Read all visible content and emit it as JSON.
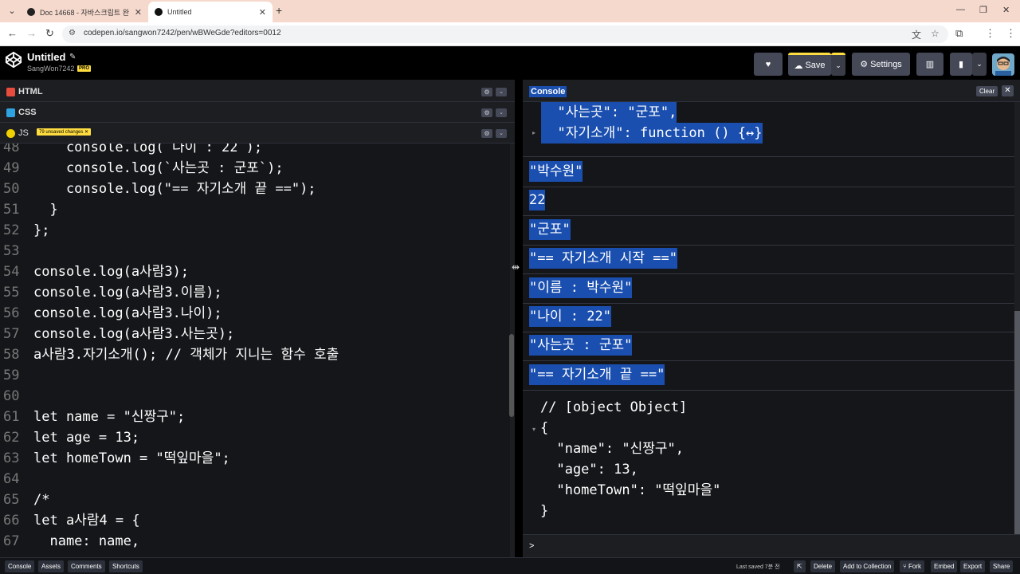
{
  "browser": {
    "tabs": [
      {
        "title": "Doc 14668 - 자바스크립트 완"
      },
      {
        "title": "Untitled"
      }
    ],
    "url": "codepen.io/sangwon7242/pen/wBWeGde?editors=0012"
  },
  "header": {
    "title": "Untitled",
    "user": "SangWon7242",
    "pro_label": "PRO",
    "save_label": "Save",
    "settings_label": "Settings"
  },
  "editors": {
    "html_label": "HTML",
    "css_label": "CSS",
    "js_label": "JS",
    "unsaved": "79 unsaved changes"
  },
  "code_lines": [
    {
      "n": "48",
      "text": "    console.log(`나이 : 22`);"
    },
    {
      "n": "49",
      "text": "    console.log(`사는곳 : 군포`);"
    },
    {
      "n": "50",
      "text": "    console.log(\"== 자기소개 끝 ==\");"
    },
    {
      "n": "51",
      "text": "  }"
    },
    {
      "n": "52",
      "text": "};"
    },
    {
      "n": "53",
      "text": ""
    },
    {
      "n": "54",
      "text": "console.log(a사람3);"
    },
    {
      "n": "55",
      "text": "console.log(a사람3.이름);"
    },
    {
      "n": "56",
      "text": "console.log(a사람3.나이);"
    },
    {
      "n": "57",
      "text": "console.log(a사람3.사는곳);"
    },
    {
      "n": "58",
      "text": "a사람3.자기소개(); // 객체가 지니는 함수 호출"
    },
    {
      "n": "59",
      "text": ""
    },
    {
      "n": "60",
      "text": ""
    },
    {
      "n": "61",
      "text": "let name = \"신짱구\";"
    },
    {
      "n": "62",
      "text": "let age = 13;"
    },
    {
      "n": "63",
      "text": "let homeTown = \"떡잎마을\";"
    },
    {
      "n": "64",
      "text": ""
    },
    {
      "n": "65",
      "text": "/*"
    },
    {
      "n": "66",
      "text": "let a사람4 = {"
    },
    {
      "n": "67",
      "text": "  name: name,"
    }
  ],
  "console": {
    "title": "Console",
    "clear_label": "Clear",
    "object_lines": [
      "  \"사는곳\": \"군포\",",
      "  \"자기소개\": function () {↔}"
    ],
    "logs": [
      "\"박수원\"",
      "22",
      "\"군포\"",
      "\"== 자기소개 시작 ==\"",
      "\"이름 : 박수원\"",
      "\"나이 : 22\"",
      "\"사는곳 : 군포\"",
      "\"== 자기소개 끝 ==\""
    ],
    "last_object": {
      "comment": "// [object Object]",
      "open": "{",
      "lines": [
        "  \"name\": \"신짱구\",",
        "  \"age\": 13,",
        "  \"homeTown\": \"떡잎마을\""
      ],
      "close": "}"
    },
    "prompt": ">"
  },
  "footer": {
    "console": "Console",
    "assets": "Assets",
    "comments": "Comments",
    "shortcuts": "Shortcuts",
    "saved": "Last saved 7분 전",
    "delete": "Delete",
    "add_collection": "Add to Collection",
    "fork": "Fork",
    "embed": "Embed",
    "export": "Export",
    "share": "Share"
  }
}
